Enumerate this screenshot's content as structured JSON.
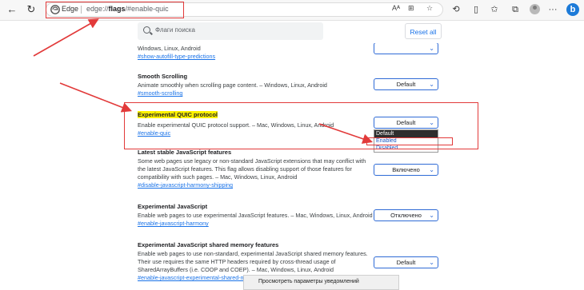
{
  "browser": {
    "site_name": "Edge",
    "url_scheme": "edge://",
    "url_host": "flags",
    "url_rest": "/#enable-quic",
    "profile_icon": "person-icon",
    "bing_label": "b"
  },
  "flags": {
    "search_placeholder": "Флаги поиска",
    "reset_label": "Reset all"
  },
  "experiments": [
    {
      "title": "",
      "description": "Windows, Linux, Android",
      "link": "#show-autofill-type-predictions",
      "value": ""
    },
    {
      "title": "Smooth Scrolling",
      "description": "Animate smoothly when scrolling page content. – Windows, Linux, Android",
      "link": "#smooth-scrolling",
      "value": "Default"
    },
    {
      "title": "Experimental QUIC protocol",
      "description": "Enable experimental QUIC protocol support. – Mac, Windows, Linux, Android",
      "link": "#enable-quic",
      "value": "Default"
    },
    {
      "title": "Latest stable JavaScript features",
      "description": "Some web pages use legacy or non-standard JavaScript extensions that may conflict with the latest JavaScript features. This flag allows disabling support of those features for compatibility with such pages. – Mac, Windows, Linux, Android",
      "link": "#disable-javascript-harmony-shipping",
      "value": "Включено"
    },
    {
      "title": "Experimental JavaScript",
      "description": "Enable web pages to use experimental JavaScript features. – Mac, Windows, Linux, Android",
      "link": "#enable-javascript-harmony",
      "value": "Отключено"
    },
    {
      "title": "Experimental JavaScript shared memory features",
      "description": "Enable web pages to use non-standard, experimental JavaScript shared memory features. Their use requires the same HTTP headers required by cross-thread usage of SharedArrayBuffers (i.e. COOP and COEP). – Mac, Windows, Linux, Android",
      "link": "#enable-javascript-experimental-shared-m",
      "value": "Default"
    }
  ],
  "quic_dropdown": {
    "options": [
      "Default",
      "Enabled",
      "Disabled"
    ],
    "highlighted": "Default"
  },
  "notification": {
    "label": "Просмотреть параметры уведомлений"
  },
  "colors": {
    "annotation": "#e23a3a",
    "highlight": "#fff200",
    "link": "#1a73e8"
  }
}
